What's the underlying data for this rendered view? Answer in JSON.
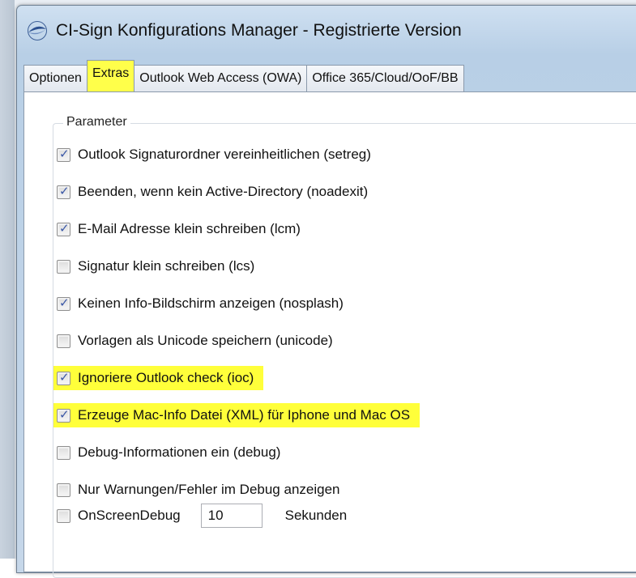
{
  "window": {
    "title": "CI-Sign Konfigurations Manager - Registrierte Version"
  },
  "tabs": [
    {
      "label": "Optionen",
      "active": false
    },
    {
      "label": "Extras",
      "active": true
    },
    {
      "label": "Outlook Web Access (OWA)",
      "active": false
    },
    {
      "label": "Office 365/Cloud/OoF/BB",
      "active": false
    }
  ],
  "group": {
    "label": "Parameter"
  },
  "options": [
    {
      "label": "Outlook Signaturordner vereinheitlichen (setreg)",
      "checked": true,
      "highlighted": false
    },
    {
      "label": "Beenden, wenn kein Active-Directory (noadexit)",
      "checked": true,
      "highlighted": false
    },
    {
      "label": "E-Mail Adresse klein schreiben (lcm)",
      "checked": true,
      "highlighted": false
    },
    {
      "label": "Signatur klein schreiben (lcs)",
      "checked": false,
      "highlighted": false
    },
    {
      "label": "Keinen Info-Bildschirm anzeigen (nosplash)",
      "checked": true,
      "highlighted": false
    },
    {
      "label": "Vorlagen als Unicode speichern (unicode)",
      "checked": false,
      "highlighted": false
    },
    {
      "label": "Ignoriere Outlook check (ioc)",
      "checked": true,
      "highlighted": true
    },
    {
      "label": "Erzeuge Mac-Info Datei (XML) für Iphone und Mac OS",
      "checked": true,
      "highlighted": true
    },
    {
      "label": "Debug-Informationen ein (debug)",
      "checked": false,
      "highlighted": false
    },
    {
      "label": "Nur Warnungen/Fehler im Debug anzeigen",
      "checked": false,
      "highlighted": false
    }
  ],
  "onscreen": {
    "label": "OnScreenDebug",
    "checked": false,
    "value": "10",
    "unit": "Sekunden"
  },
  "colors": {
    "highlight": "#ffff3a",
    "check": "#3a57a6"
  },
  "icons": {
    "app": "ci-sign-app-icon",
    "check": "checkmark-icon"
  }
}
